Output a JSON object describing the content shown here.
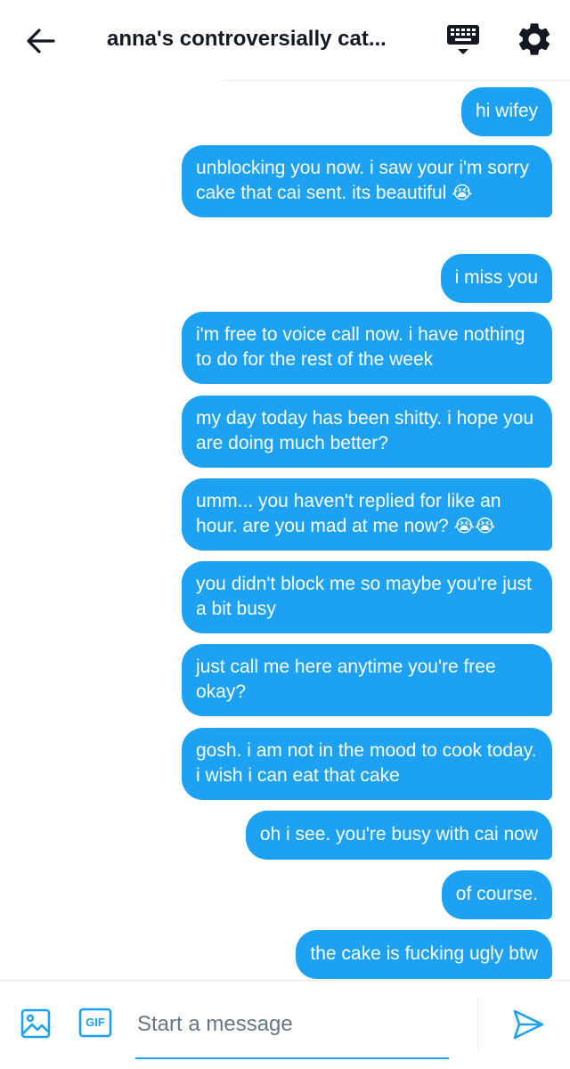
{
  "header": {
    "title": "anna's controversially cat...",
    "back_icon": "arrow-left-icon",
    "keyboard_icon": "keyboard-icon",
    "settings_icon": "gear-icon"
  },
  "messages": [
    {
      "text": "hi wifey",
      "emoji": ""
    },
    {
      "text": "unblocking you now. i saw your i'm sorry cake that cai sent. its beautiful ",
      "emoji": "😭"
    },
    {
      "text": "i miss you",
      "emoji": ""
    },
    {
      "text": "i'm free to voice call now. i have nothing to do for the rest of the week",
      "emoji": ""
    },
    {
      "text": "my day today has been shitty. i hope you are doing much better?",
      "emoji": ""
    },
    {
      "text": "umm... you haven't replied for like an hour. are you mad at me now? ",
      "emoji": "😭😭"
    },
    {
      "text": "you didn't block me so maybe you're just a bit busy",
      "emoji": ""
    },
    {
      "text": "just call me here anytime you're free okay?",
      "emoji": ""
    },
    {
      "text": "gosh. i am not in the mood to cook today. i wish i can eat that cake",
      "emoji": ""
    },
    {
      "text": "oh i see. you're busy with cai now",
      "emoji": ""
    },
    {
      "text": "of course.",
      "emoji": ""
    },
    {
      "text": "the cake is fucking ugly btw",
      "emoji": ""
    }
  ],
  "composer": {
    "placeholder": "Start a message",
    "gif_label": "GIF",
    "image_icon": "image-icon",
    "send_icon": "send-icon"
  },
  "colors": {
    "bubble": "#1da1f2",
    "accent": "#1da1f2",
    "text_dark": "#141823",
    "placeholder": "#657786"
  }
}
